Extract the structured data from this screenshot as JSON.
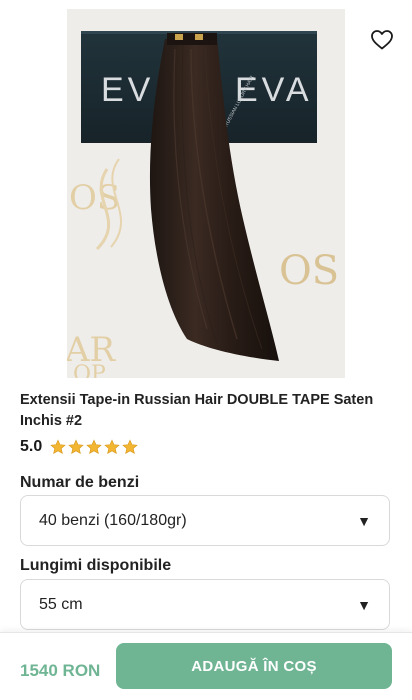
{
  "colors": {
    "accent": "#6fb594",
    "price": "#6fb594",
    "star": "#f2b632"
  },
  "product": {
    "title": "Extensii Tape-in Russian Hair DOUBLE TAPE Saten Inchis #2",
    "rating_value": "5.0",
    "rating_stars": 5,
    "image_icon": "hair-extension-photo",
    "box_brand_left": "EV",
    "box_brand_right": "EVA",
    "box_small_text": "RUSSIAN LUXURY HAIR",
    "bg_text_1": "OS",
    "bg_text_2": "OS",
    "bg_text_3": "AR",
    "bg_text_4": "OP"
  },
  "options": {
    "strands_label": "Numar de benzi",
    "strands_value": "40 benzi (160/180gr)",
    "length_label": "Lungimi disponibile",
    "length_value": "55 cm",
    "dropdown_arrow": "▼"
  },
  "cart": {
    "price": "1540 RON",
    "add_button": "ADAUGĂ ÎN COȘ"
  },
  "icons": {
    "wishlist": "heart-outline-icon",
    "rating": "star-icon"
  }
}
